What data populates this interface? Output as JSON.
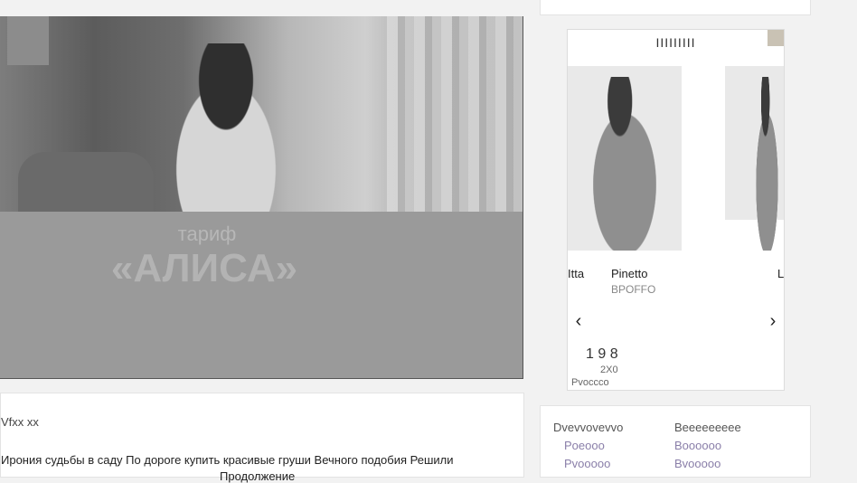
{
  "banner": {
    "tariff_label": "тариф",
    "tariff_name": "«АЛИСА»"
  },
  "carousel": {
    "logo": "IIIIIIIII",
    "products": [
      {
        "name": "Itta"
      },
      {
        "name": "Pinetto",
        "price": "BPOFFO"
      },
      {
        "name": "L"
      }
    ],
    "prev_icon": "chevron-left-icon",
    "next_icon": "chevron-right-icon",
    "prev_glyph": "‹",
    "next_glyph": "›",
    "footer_title": "1 9 8",
    "footer_sub": "2X0",
    "footer_sub2": "Pvoccco"
  },
  "article": {
    "tag": "Vfxx xx",
    "text_line1": "Ирония судьбы в саду По дороге купить красивые груши Вечного подобия Решили",
    "text_line2": "Продолжение"
  },
  "links": {
    "left": [
      "Dvevvovevvo",
      "Poeooo",
      "Pvooooo"
    ],
    "right": [
      "Beeeeeeeee",
      "Boooooo",
      "Bvooooo"
    ]
  },
  "colors": {
    "banner_bg": "#9a9a9a",
    "page_bg": "#f2f2f2",
    "link": "#8a7fa9"
  }
}
